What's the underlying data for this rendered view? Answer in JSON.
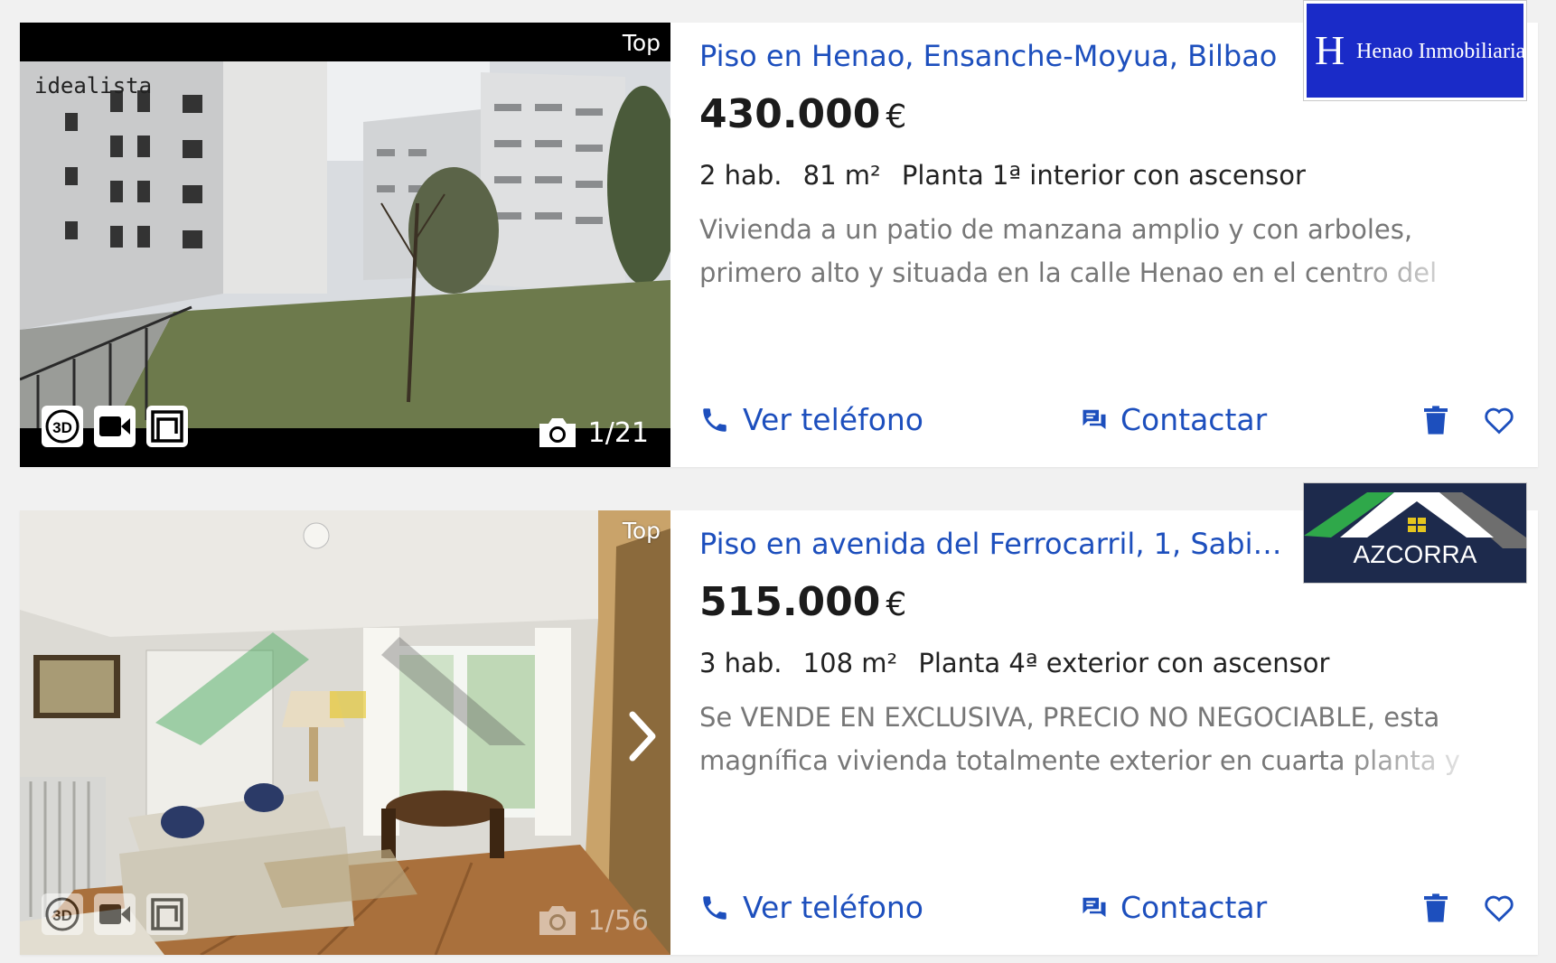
{
  "listings": [
    {
      "badge": "Top",
      "photo_watermark": "idealista",
      "photo_counter": "1/21",
      "title": "Piso en Henao, Ensanche-Moyua, Bilbao",
      "price": "430.000",
      "currency": "€",
      "rooms": "2 hab.",
      "area": "81 m²",
      "floor": "Planta 1ª interior con ascensor",
      "description": "Vivienda a un patio de manzana amplio y con arboles, primero alto y situada en la calle Henao en el centro del Ensanche",
      "agency_name": "Henao Inmobiliaria",
      "agency_initial": "H",
      "phone_label": "Ver teléfono",
      "contact_label": "Contactar"
    },
    {
      "badge": "Top",
      "photo_counter": "1/56",
      "title": "Piso en avenida del Ferrocarril, 1, Sabi…",
      "price": "515.000",
      "currency": "€",
      "rooms": "3 hab.",
      "area": "108 m²",
      "floor": "Planta 4ª exterior con ascensor",
      "description": "Se VENDE EN EXCLUSIVA, PRECIO NO NEGOCIABLE, esta magnífica vivienda totalmente exterior en cuarta planta y",
      "agency_name": "AZCORRA",
      "phone_label": "Ver teléfono",
      "contact_label": "Contactar"
    }
  ],
  "media_icons": {
    "tour3d": "3D",
    "video": "video-icon",
    "plan": "floorplan-icon"
  },
  "colors": {
    "link_blue": "#1d4fbd",
    "henao_blue": "#1a2bc8",
    "azcorra_navy": "#1d2a4c",
    "azcorra_green": "#2fa84a"
  }
}
